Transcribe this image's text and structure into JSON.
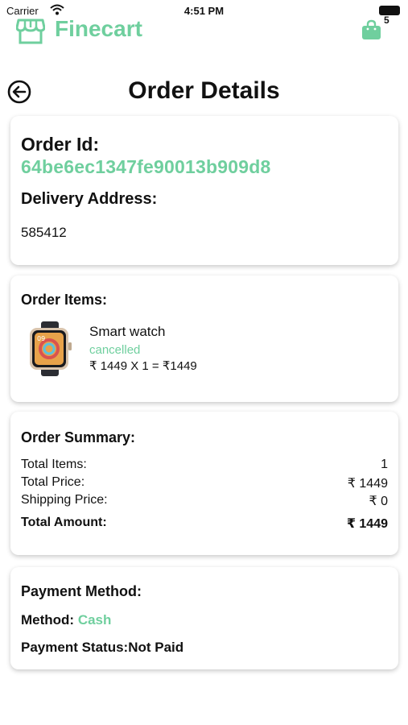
{
  "status_bar": {
    "carrier": "Carrier",
    "time": "4:51 PM"
  },
  "header": {
    "brand": "Finecart",
    "cart_count": "5"
  },
  "page": {
    "title": "Order Details"
  },
  "order": {
    "id_label": "Order Id:",
    "id": "64be6ec1347fe90013b909d8",
    "address_label": "Delivery Address:",
    "address": "585412"
  },
  "items_section": {
    "label": "Order Items:",
    "items": [
      {
        "name": "Smart watch",
        "status": "cancelled",
        "calc": "₹ 1449 X 1 = ₹1449"
      }
    ]
  },
  "summary": {
    "label": "Order Summary:",
    "total_items_label": "Total Items:",
    "total_items": "1",
    "total_price_label": "Total Price:",
    "total_price": "₹ 1449",
    "shipping_label": "Shipping Price:",
    "shipping": "₹ 0",
    "total_amount_label": "Total Amount:",
    "total_amount": "₹ 1449"
  },
  "payment": {
    "label": "Payment Method:",
    "method_label": "Method: ",
    "method": "Cash",
    "status_label": "Payment Status:",
    "status": "Not Paid"
  },
  "colors": {
    "accent": "#6fcf9e"
  }
}
